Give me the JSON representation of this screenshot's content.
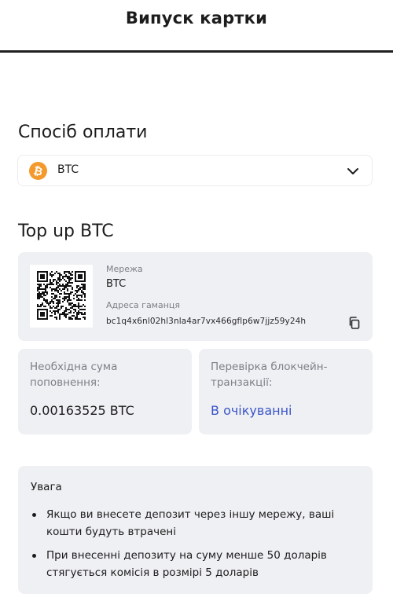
{
  "header": {
    "title": "Випуск картки"
  },
  "payment_method": {
    "title": "Спосіб оплати",
    "selected": "BTC",
    "icon": "bitcoin-icon",
    "accent_color": "#f49a2c"
  },
  "topup": {
    "title": "Top up BTC",
    "network_label": "Мережа",
    "network_value": "BTC",
    "address_label": "Адреса гаманця",
    "address_value": "bc1q4x6nl02hl3nla4ar7vx466gflp6w7jjz59y24h",
    "copy_icon": "copy-icon"
  },
  "amount": {
    "label": "Необхідна сума поповнення:",
    "value": "0.00163525 BTC"
  },
  "verification": {
    "label": "Перевірка блокчейн-транзакції:",
    "value": "В очікуванні",
    "color": "#3a55c8"
  },
  "warning": {
    "title": "Увага",
    "items": [
      "Якщо ви внесете депозит через іншу мережу, ваші кошти будуть втрачені",
      "При внесенні депозиту на суму менше 50 доларів стягується комісія в розмірі 5 доларів"
    ]
  }
}
